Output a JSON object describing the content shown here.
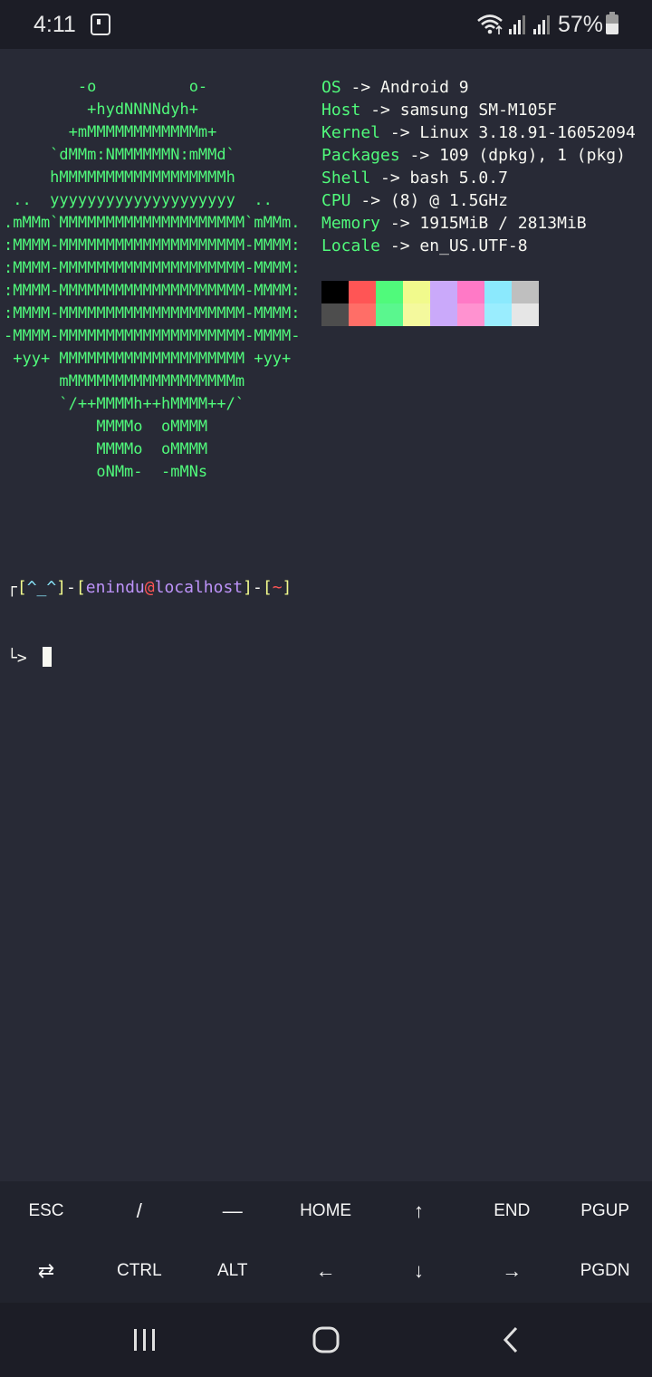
{
  "status_bar": {
    "time": "4:11",
    "battery_percent": "57%",
    "icons": [
      "notification-icon",
      "wifi-icon",
      "signal-icon",
      "signal-icon",
      "battery-icon"
    ]
  },
  "terminal": {
    "ascii_logo": [
      "        -o          o-",
      "         +hydNNNNdyh+",
      "       +mMMMMMMMMMMMMm+",
      "     `dMMm:NMMMMMMN:mMMd`",
      "     hMMMMMMMMMMMMMMMMMMh",
      " ..  yyyyyyyyyyyyyyyyyyyy  ..",
      ".mMMm`MMMMMMMMMMMMMMMMMMMM`mMMm.",
      ":MMMM-MMMMMMMMMMMMMMMMMMMM-MMMM:",
      ":MMMM-MMMMMMMMMMMMMMMMMMMM-MMMM:",
      ":MMMM-MMMMMMMMMMMMMMMMMMMM-MMMM:",
      ":MMMM-MMMMMMMMMMMMMMMMMMMM-MMMM:",
      "-MMMM-MMMMMMMMMMMMMMMMMMMM-MMMM-",
      " +yy+ MMMMMMMMMMMMMMMMMMMM +yy+",
      "      mMMMMMMMMMMMMMMMMMMm",
      "      `/++MMMMh++hMMMM++/`",
      "          MMMMo  oMMMM",
      "          MMMMo  oMMMM",
      "          oNMm-  -mMNs"
    ],
    "sysinfo": [
      {
        "key": "OS",
        "arrow": " -> ",
        "value": "Android 9"
      },
      {
        "key": "Host",
        "arrow": " -> ",
        "value": "samsung SM-M105F"
      },
      {
        "key": "Kernel",
        "arrow": " -> ",
        "value": "Linux 3.18.91-16052094"
      },
      {
        "key": "Packages",
        "arrow": " -> ",
        "value": "109 (dpkg), 1 (pkg)"
      },
      {
        "key": "Shell",
        "arrow": " -> ",
        "value": "bash 5.0.7"
      },
      {
        "key": "CPU",
        "arrow": " -> ",
        "value": "(8) @ 1.5GHz"
      },
      {
        "key": "Memory",
        "arrow": " -> ",
        "value": "1915MiB / 2813MiB"
      },
      {
        "key": "Locale",
        "arrow": " -> ",
        "value": "en_US.UTF-8"
      }
    ],
    "palette": {
      "normal": [
        "#000000",
        "#ff5555",
        "#50fa7b",
        "#f1fa8c",
        "#caa9fa",
        "#ff79c6",
        "#8be9fd",
        "#bfbfbf"
      ],
      "bright": [
        "#4d4d4d",
        "#ff6e67",
        "#5af78e",
        "#f4f99d",
        "#caa9fa",
        "#ff92d0",
        "#9aedfe",
        "#e6e6e6"
      ]
    },
    "prompt": {
      "corner": "┌",
      "open1": "[",
      "face": "^_^",
      "close1": "]",
      "dash1": "-",
      "open2": "[",
      "user": "enindu",
      "at": "@",
      "host": "localhost",
      "close2": "]",
      "dash2": "-",
      "open3": "[",
      "cwd": "~",
      "close3": "]",
      "line2": "└> "
    }
  },
  "extra_keys": {
    "row1": [
      "ESC",
      "/",
      "—",
      "HOME",
      "↑",
      "END",
      "PGUP"
    ],
    "row2": [
      "⇄",
      "CTRL",
      "ALT",
      "←",
      "↓",
      "→",
      "PGDN"
    ]
  },
  "nav_bar": {
    "buttons": [
      "recents-icon",
      "home-icon",
      "back-icon"
    ]
  }
}
